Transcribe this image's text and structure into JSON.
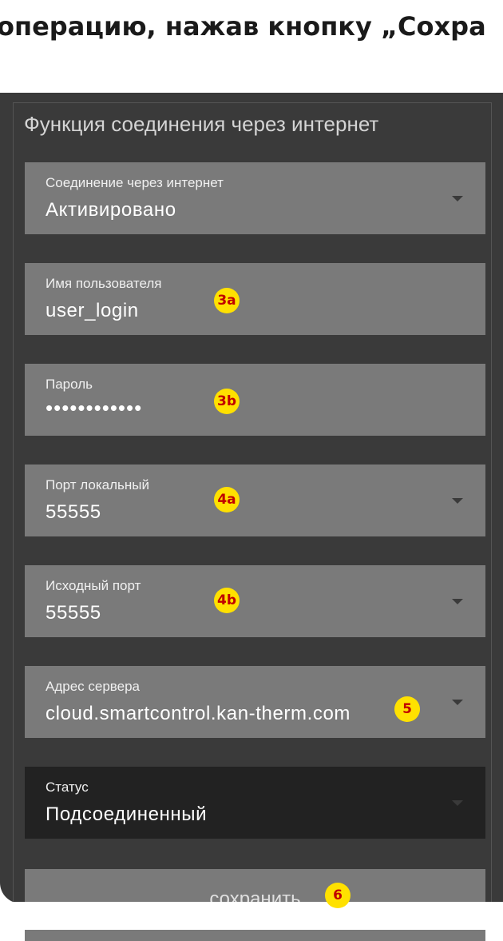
{
  "caption": "операцию, нажав кнопку „Сохра",
  "section_title": "Функция соединения через интернет",
  "fields": {
    "connection": {
      "label": "Соединение через интернет",
      "value": "Активировано"
    },
    "username": {
      "label": "Имя пользователя",
      "value": "user_login",
      "badge": "3a"
    },
    "password": {
      "label": "Пароль",
      "value": "••••••••••••",
      "badge": "3b"
    },
    "local_port": {
      "label": "Порт локальный",
      "value": "55555",
      "badge": "4a"
    },
    "source_port": {
      "label": "Исходный порт",
      "value": "55555",
      "badge": "4b"
    },
    "server": {
      "label": "Адрес сервера",
      "value": "cloud.smartcontrol.kan-therm.com",
      "badge": "5"
    },
    "status": {
      "label": "Статус",
      "value": "Подсоединенный"
    }
  },
  "save": {
    "label": "сохранить",
    "badge": "6"
  },
  "colors": {
    "panel": "#3a3a3a",
    "field": "#7a7a7a",
    "field_dark": "#222222",
    "badge": "#ffe100",
    "badge_text": "#c00000"
  }
}
